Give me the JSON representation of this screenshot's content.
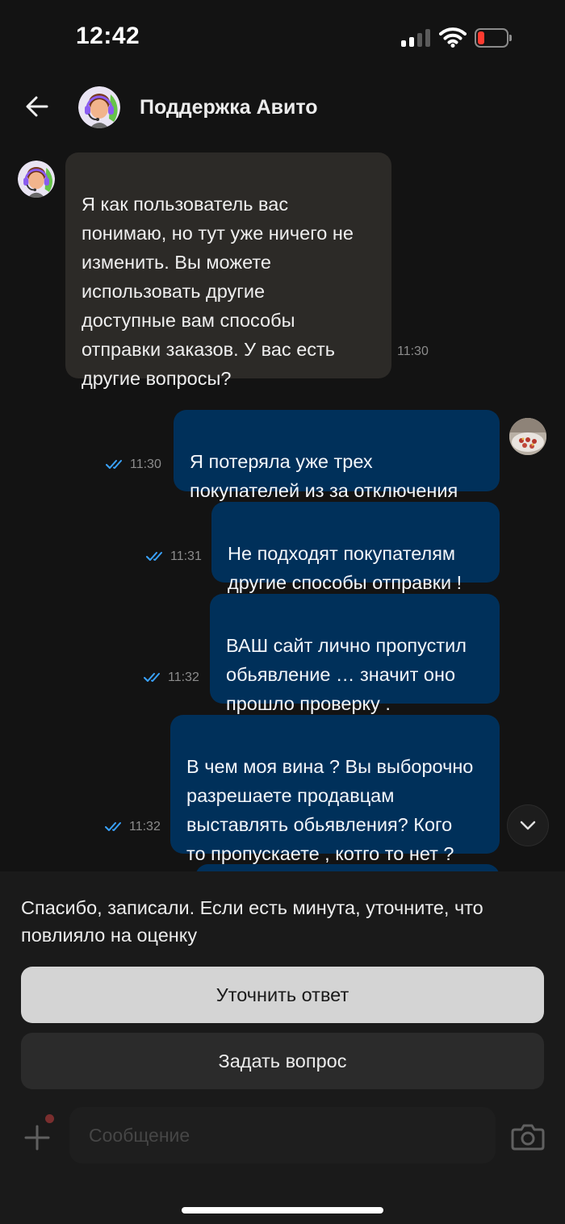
{
  "status_bar": {
    "time": "12:42",
    "battery_color": "#ff3b30"
  },
  "header": {
    "title": "Поддержка Авито",
    "back_icon": "arrow-left-icon",
    "avatar_icon": "support-agent-avatar"
  },
  "messages": [
    {
      "direction": "in",
      "text": "Я как пользователь вас\nпонимаю, но тут уже ничего не\nизменить. Вы можете\nиспользовать другие\nдоступные вам способы\nотправки заказов. У вас есть\nдругие вопросы?",
      "time": "11:30"
    },
    {
      "direction": "out",
      "text": "Я потеряла уже трех\nпокупателей из за отключения",
      "time": "11:30",
      "read": true
    },
    {
      "direction": "out",
      "text": "Не подходят покупателям\nдругие способы отправки !",
      "time": "11:31",
      "read": true
    },
    {
      "direction": "out",
      "text": "ВАШ сайт лично пропустил\nобьявление … значит оно\nпрошло проверку .",
      "time": "11:32",
      "read": true
    },
    {
      "direction": "out",
      "text": "В чем моя вина ? Вы выборочно\nразрешаете продавцам\nвыставлять обьявления? Кого\nто пропускаете , котго то нет ?",
      "time": "11:32",
      "read": true
    }
  ],
  "sheet": {
    "feedback_text": "Спасибо, записали. Если есть минута, уточните, что повлияло на оценку",
    "primary_button": "Уточнить ответ",
    "secondary_button": "Задать вопрос"
  },
  "composer": {
    "placeholder": "Сообщение"
  },
  "colors": {
    "background": "#131313",
    "incoming_bubble": "#2c2a27",
    "outgoing_bubble": "#00305a",
    "read_check": "#3aa3ff"
  }
}
